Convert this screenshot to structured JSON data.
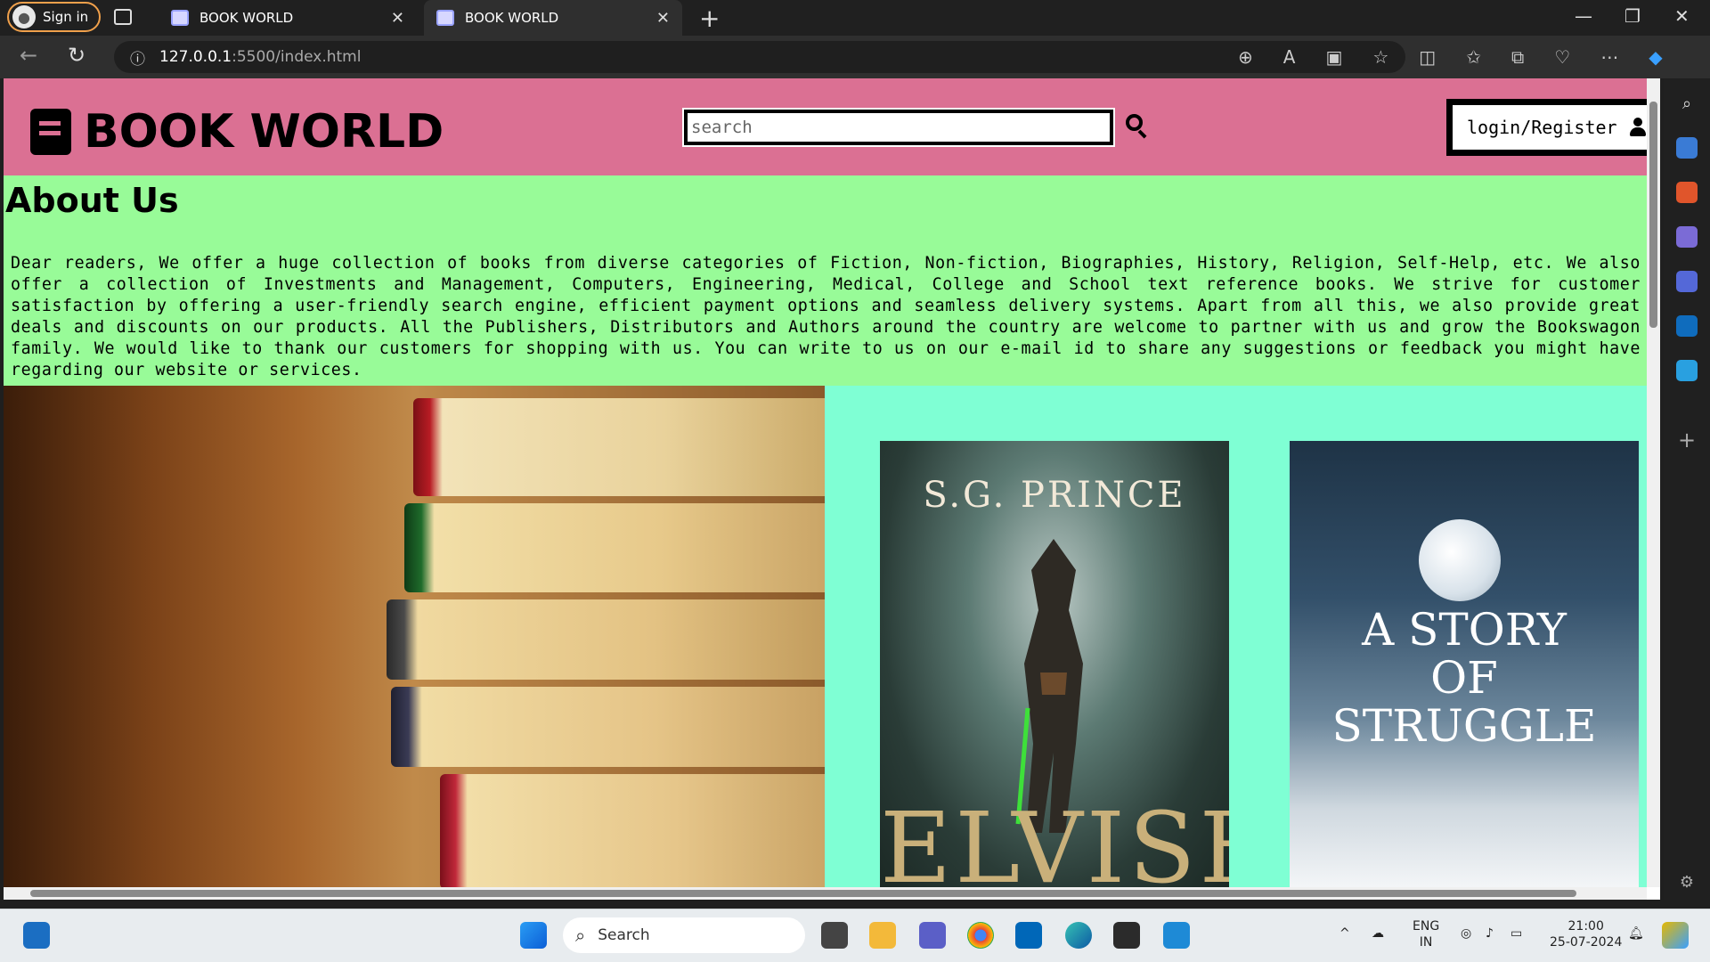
{
  "browser": {
    "sign_in_label": "Sign in",
    "tabs": [
      {
        "title": "BOOK WORLD",
        "active": false
      },
      {
        "title": "BOOK WORLD",
        "active": true
      }
    ],
    "url_host": "127.0.0.1",
    "url_path": ":5500/index.html"
  },
  "site": {
    "logo_text": "BOOK WORLD",
    "search_placeholder": "search",
    "login_label": "login/Register"
  },
  "about": {
    "heading": "About Us",
    "body": "Dear readers, We offer a huge collection of books from diverse categories of Fiction, Non-fiction, Biographies, History, Religion, Self-Help, etc. We also offer a collection of Investments and Management, Computers, Engineering, Medical, College and School text reference books. We strive for customer satisfaction by offering a user-friendly search engine, efficient payment options and seamless delivery systems. Apart from all this, we also provide great deals and discounts on our products. All the Publishers, Distributors and Authors around the country are welcome to partner with us and grow the Bookswagon family. We would like to thank our customers for shopping with us. You can write to us on our e-mail id to share any suggestions or feedback you might have regarding our website or services."
  },
  "gallery": {
    "cover1": {
      "author": "S.G. PRINCE",
      "title": "ELVISH"
    },
    "cover2": {
      "title_line1": "A STORY",
      "title_line2": "OF",
      "title_line3": "STRUGGLE"
    }
  },
  "taskbar": {
    "search_label": "Search",
    "lang_top": "ENG",
    "lang_bottom": "IN",
    "time": "21:00",
    "date": "25-07-2024"
  },
  "colors": {
    "header_bg": "#db7093",
    "about_bg": "#98fb98",
    "gallery_bg": "#7fffd4"
  }
}
